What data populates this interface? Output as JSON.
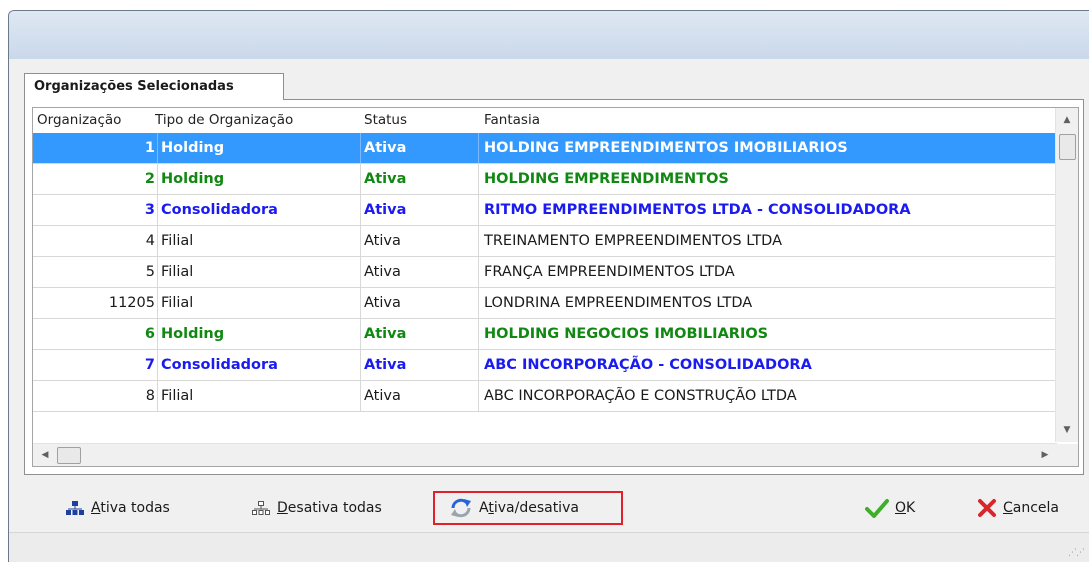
{
  "tab": {
    "label": "Organizações Selecionadas"
  },
  "grid": {
    "columns": [
      "Organização",
      "Tipo de Organização",
      "Status",
      "Fantasia"
    ],
    "rows": [
      {
        "id": "1",
        "tipo": "Holding",
        "status": "Ativa",
        "fantasia": "HOLDING EMPREENDIMENTOS IMOBILIARIOS",
        "style": "selected-bold"
      },
      {
        "id": "2",
        "tipo": "Holding",
        "status": "Ativa",
        "fantasia": "HOLDING EMPREENDIMENTOS",
        "style": "green-bold"
      },
      {
        "id": "3",
        "tipo": "Consolidadora",
        "status": "Ativa",
        "fantasia": "RITMO EMPREENDIMENTOS LTDA - CONSOLIDADORA",
        "style": "blue-bold"
      },
      {
        "id": "4",
        "tipo": "Filial",
        "status": "Ativa",
        "fantasia": "TREINAMENTO EMPREENDIMENTOS LTDA",
        "style": "normal"
      },
      {
        "id": "5",
        "tipo": "Filial",
        "status": "Ativa",
        "fantasia": "FRANÇA EMPREENDIMENTOS LTDA",
        "style": "normal"
      },
      {
        "id": "11205",
        "tipo": "Filial",
        "status": "Ativa",
        "fantasia": "LONDRINA EMPREENDIMENTOS LTDA",
        "style": "normal"
      },
      {
        "id": "6",
        "tipo": "Holding",
        "status": "Ativa",
        "fantasia": "HOLDING NEGOCIOS IMOBILIARIOS",
        "style": "green-bold"
      },
      {
        "id": "7",
        "tipo": "Consolidadora",
        "status": "Ativa",
        "fantasia": "ABC INCORPORAÇÃO - CONSOLIDADORA",
        "style": "blue-bold"
      },
      {
        "id": "8",
        "tipo": "Filial",
        "status": "Ativa",
        "fantasia": "ABC INCORPORAÇÃO E CONSTRUÇÃO LTDA",
        "style": "normal"
      }
    ]
  },
  "buttons": {
    "ativa_todas": {
      "accel": "A",
      "rest": "tiva todas",
      "icon": "org-chart-icon"
    },
    "desativa_todas": {
      "accel": "D",
      "rest": "esativa todas",
      "icon": "org-chart-outline-icon"
    },
    "ativa_desativa": {
      "pre": "A",
      "accel": "t",
      "rest": "iva/desativa",
      "icon": "refresh-icon"
    },
    "ok": {
      "accel": "O",
      "rest": "K",
      "icon": "checkmark-icon"
    },
    "cancela": {
      "accel": "C",
      "rest": "ancela",
      "icon": "close-x-icon"
    }
  },
  "colors": {
    "selection": "#3399ff",
    "green_text": "#118811",
    "blue_text": "#1b1bf0",
    "highlight_border": "#e0202a"
  }
}
